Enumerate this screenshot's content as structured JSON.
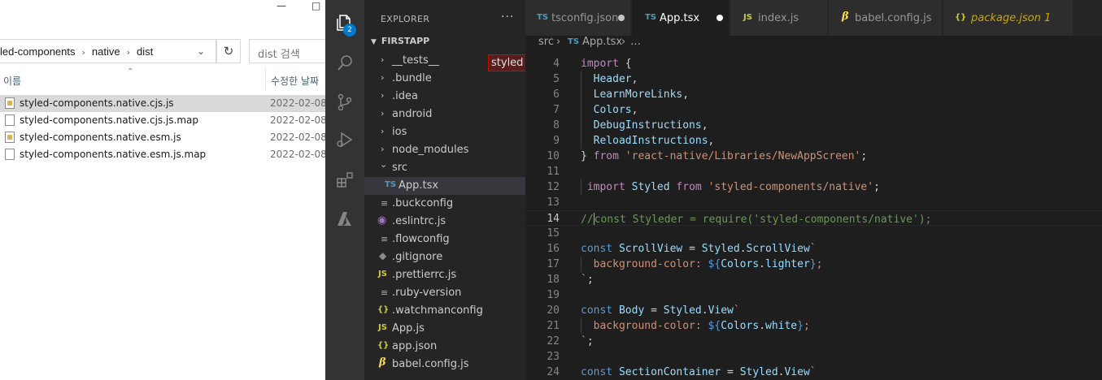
{
  "explorer": {
    "window_controls": [
      "—",
      "□"
    ],
    "address": [
      "led-components",
      "native",
      "dist"
    ],
    "search_placeholder": "dist 검색",
    "columns": {
      "name": "이름",
      "date": "수정한 날짜"
    },
    "files": [
      {
        "name": "styled-components.native.cjs.js",
        "date": "2022-02-08",
        "type": "js",
        "selected": true
      },
      {
        "name": "styled-components.native.cjs.js.map",
        "date": "2022-02-08",
        "type": "map",
        "selected": false
      },
      {
        "name": "styled-components.native.esm.js",
        "date": "2022-02-08",
        "type": "js",
        "selected": false
      },
      {
        "name": "styled-components.native.esm.js.map",
        "date": "2022-02-08",
        "type": "map",
        "selected": false
      }
    ]
  },
  "activity": {
    "explorer_badge": "2"
  },
  "sidebar": {
    "title": "EXPLORER",
    "more": "···",
    "project": "FIRSTAPP",
    "tree": [
      {
        "label": "__tests__",
        "kind": "folder",
        "icon": "›"
      },
      {
        "label": ".bundle",
        "kind": "folder",
        "icon": "›"
      },
      {
        "label": ".idea",
        "kind": "folder",
        "icon": "›"
      },
      {
        "label": "android",
        "kind": "folder",
        "icon": "›"
      },
      {
        "label": "ios",
        "kind": "folder",
        "icon": "›"
      },
      {
        "label": "node_modules",
        "kind": "folder",
        "icon": "›"
      },
      {
        "label": "src",
        "kind": "folder-open",
        "icon": "⌄"
      },
      {
        "label": "App.tsx",
        "kind": "ts",
        "icon": "TS"
      },
      {
        "label": ".buckconfig",
        "kind": "lines",
        "icon": "≡"
      },
      {
        "label": ".eslintrc.js",
        "kind": "eslint",
        "icon": "◉"
      },
      {
        "label": ".flowconfig",
        "kind": "lines",
        "icon": "≡"
      },
      {
        "label": ".gitignore",
        "kind": "gi",
        "icon": "◆"
      },
      {
        "label": ".prettierrc.js",
        "kind": "js",
        "icon": "JS"
      },
      {
        "label": ".ruby-version",
        "kind": "lines",
        "icon": "≡"
      },
      {
        "label": ".watchmanconfig",
        "kind": "jsn",
        "icon": "{}"
      },
      {
        "label": "App.js",
        "kind": "js",
        "icon": "JS"
      },
      {
        "label": "app.json",
        "kind": "jsn",
        "icon": "{}"
      },
      {
        "label": "babel.config.js",
        "kind": "babel",
        "icon": "β"
      }
    ],
    "tooltip": "styled"
  },
  "tabs": [
    {
      "label": "tsconfig.json",
      "icon": "TS",
      "dirty": true,
      "active": false
    },
    {
      "label": "App.tsx",
      "icon": "TS",
      "dirty": true,
      "active": true
    },
    {
      "label": "index.js",
      "icon": "JS",
      "dirty": false,
      "active": false
    },
    {
      "label": "babel.config.js",
      "icon": "β",
      "dirty": false,
      "active": false
    },
    {
      "label": "package.json 1",
      "icon": "{}",
      "dirty": false,
      "active": false,
      "modified": true
    }
  ],
  "breadcrumb": {
    "folder": "src",
    "sep": "›",
    "file_icon": "TS",
    "file": "App.tsx",
    "tail": "…"
  },
  "code": {
    "line_numbers": [
      "4",
      "5",
      "6",
      "7",
      "8",
      "9",
      "10",
      "11",
      "12",
      "13",
      "14",
      "15",
      "16",
      "17",
      "18",
      "19",
      "20",
      "21",
      "22",
      "23",
      "24"
    ],
    "lines": [
      [
        [
          "kw2",
          "import"
        ],
        [
          "pn",
          " {"
        ]
      ],
      [
        [
          "pn",
          "  "
        ],
        [
          "id",
          "Header"
        ],
        [
          "pn",
          ","
        ]
      ],
      [
        [
          "pn",
          "  "
        ],
        [
          "id",
          "LearnMoreLinks"
        ],
        [
          "pn",
          ","
        ]
      ],
      [
        [
          "pn",
          "  "
        ],
        [
          "id",
          "Colors"
        ],
        [
          "pn",
          ","
        ]
      ],
      [
        [
          "pn",
          "  "
        ],
        [
          "id",
          "DebugInstructions"
        ],
        [
          "pn",
          ","
        ]
      ],
      [
        [
          "pn",
          "  "
        ],
        [
          "id",
          "ReloadInstructions"
        ],
        [
          "pn",
          ","
        ]
      ],
      [
        [
          "pn",
          "} "
        ],
        [
          "kw2",
          "from"
        ],
        [
          "pn",
          " "
        ],
        [
          "str",
          "'react-native/Libraries/NewAppScreen'"
        ],
        [
          "pn",
          ";"
        ]
      ],
      [],
      [
        [
          "pn",
          " "
        ],
        [
          "kw2",
          "import"
        ],
        [
          "pn",
          " "
        ],
        [
          "id",
          "Styled"
        ],
        [
          "pn",
          " "
        ],
        [
          "kw2",
          "from"
        ],
        [
          "pn",
          " "
        ],
        [
          "str",
          "'styled-components/native'"
        ],
        [
          "pn",
          ";"
        ]
      ],
      [],
      [
        [
          "cm",
          "//"
        ],
        [
          "caret",
          ""
        ],
        [
          "cm",
          "const Styleder = require('styled-components/native');"
        ]
      ],
      [],
      [
        [
          "kw",
          "const"
        ],
        [
          "pn",
          " "
        ],
        [
          "id",
          "ScrollView"
        ],
        [
          "pn",
          " = "
        ],
        [
          "id",
          "Styled"
        ],
        [
          "pn",
          "."
        ],
        [
          "id",
          "ScrollView"
        ],
        [
          "str",
          "`"
        ]
      ],
      [
        [
          "str",
          "  background-color: "
        ],
        [
          "kw",
          "${"
        ],
        [
          "id",
          "Colors"
        ],
        [
          "pn",
          "."
        ],
        [
          "id",
          "lighter"
        ],
        [
          "kw",
          "}"
        ],
        [
          "str",
          ";"
        ]
      ],
      [
        [
          "str",
          "`"
        ],
        [
          "pn",
          ";"
        ]
      ],
      [],
      [
        [
          "kw",
          "const"
        ],
        [
          "pn",
          " "
        ],
        [
          "id",
          "Body"
        ],
        [
          "pn",
          " = "
        ],
        [
          "id",
          "Styled"
        ],
        [
          "pn",
          "."
        ],
        [
          "id",
          "View"
        ],
        [
          "str",
          "`"
        ]
      ],
      [
        [
          "str",
          "  background-color: "
        ],
        [
          "kw",
          "${"
        ],
        [
          "id",
          "Colors"
        ],
        [
          "pn",
          "."
        ],
        [
          "id",
          "white"
        ],
        [
          "kw",
          "}"
        ],
        [
          "str",
          ";"
        ]
      ],
      [
        [
          "str",
          "`"
        ],
        [
          "pn",
          ";"
        ]
      ],
      [],
      [
        [
          "kw",
          "const"
        ],
        [
          "pn",
          " "
        ],
        [
          "id",
          "SectionContainer"
        ],
        [
          "pn",
          " = "
        ],
        [
          "id",
          "Styled"
        ],
        [
          "pn",
          "."
        ],
        [
          "id",
          "View"
        ],
        [
          "str",
          "`"
        ]
      ]
    ]
  }
}
